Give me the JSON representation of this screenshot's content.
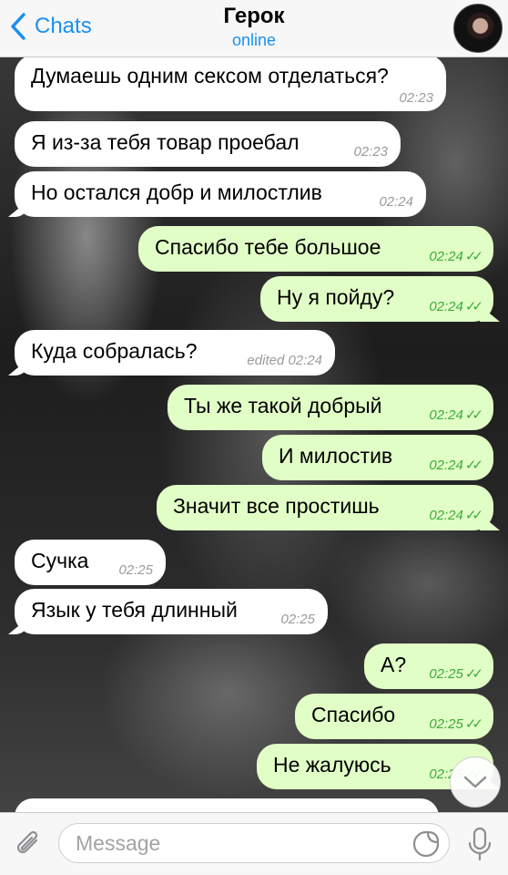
{
  "header": {
    "back_label": "Chats",
    "title": "Герок",
    "status": "online"
  },
  "messages": [
    {
      "dir": "in",
      "text": "Думаешь одним сексом отделаться?",
      "time": "02:23"
    },
    {
      "dir": "in",
      "text": "Я из-за тебя товар проебал",
      "time": "02:23"
    },
    {
      "dir": "in",
      "text": "Но остался добр и милостлив",
      "time": "02:24"
    },
    {
      "dir": "out",
      "text": "Спасибо тебе большое",
      "time": "02:24"
    },
    {
      "dir": "out",
      "text": "Ну я пойду?",
      "time": "02:24"
    },
    {
      "dir": "in",
      "text": "Куда собралась?",
      "time": "edited 02:24"
    },
    {
      "dir": "out",
      "text": "Ты же такой добрый",
      "time": "02:24"
    },
    {
      "dir": "out",
      "text": "И милостив",
      "time": "02:24"
    },
    {
      "dir": "out",
      "text": "Значит все простишь",
      "time": "02:24"
    },
    {
      "dir": "in",
      "text": "Сучка",
      "time": "02:25"
    },
    {
      "dir": "in",
      "text": "Язык у тебя длинный",
      "time": "02:25"
    },
    {
      "dir": "out",
      "text": "А?",
      "time": "02:25"
    },
    {
      "dir": "out",
      "text": "Спасибо",
      "time": "02:25"
    },
    {
      "dir": "out",
      "text": "Не жалуюсь",
      "time": "02:25"
    }
  ],
  "checks": "✓✓",
  "input": {
    "placeholder": "Message"
  },
  "colors": {
    "accent": "#1a8ff0",
    "outgoing_bubble": "#e1fec6",
    "incoming_bubble": "#ffffff",
    "outgoing_time": "#3fab3f"
  },
  "icons": [
    "back-chevron-icon",
    "attach-icon",
    "sticker-icon",
    "mic-icon",
    "chevron-down-icon"
  ]
}
